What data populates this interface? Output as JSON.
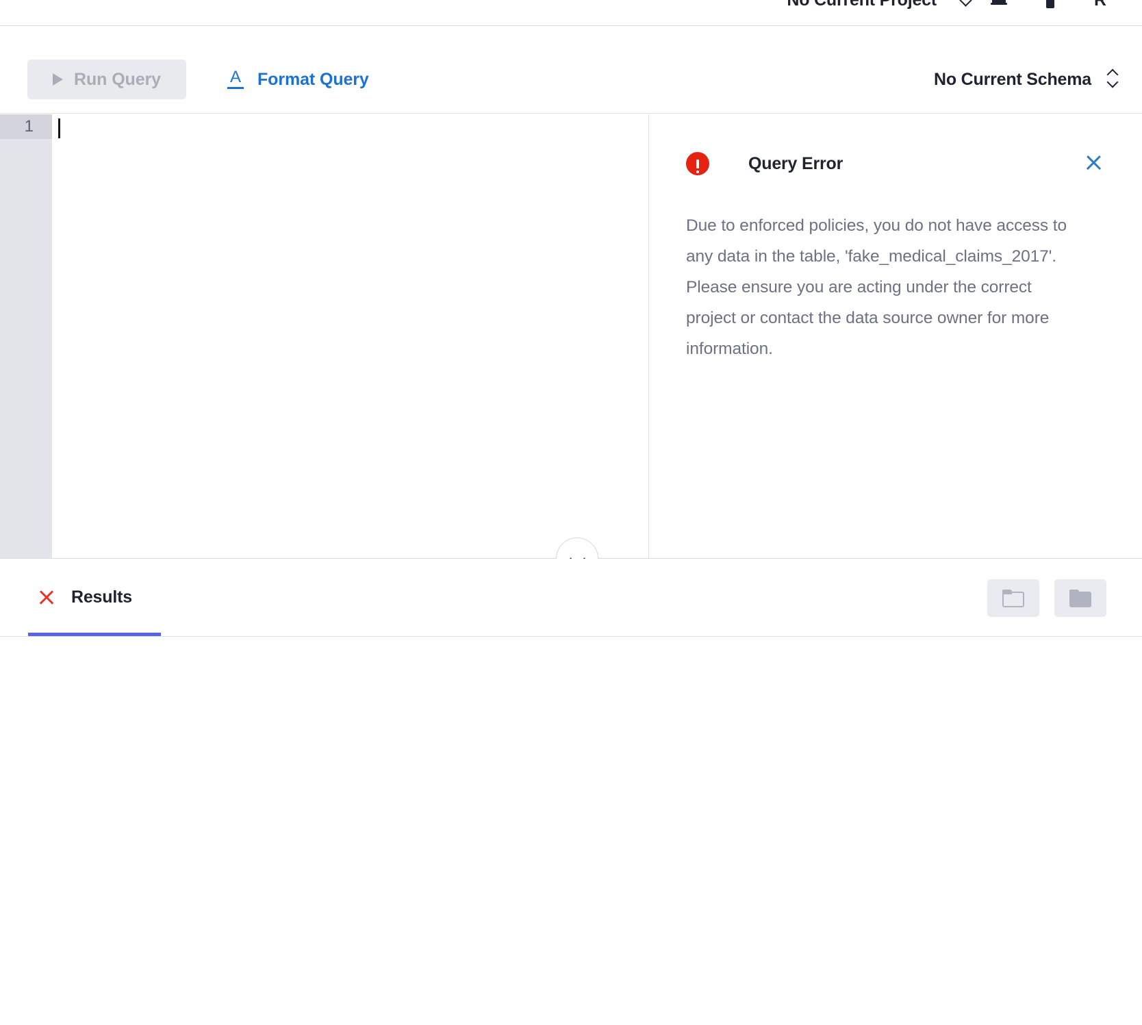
{
  "header": {
    "project_selector": {
      "label": "No Current Project",
      "chevron_icon": "chevron-down-icon"
    },
    "notifications_icon": "bell-icon",
    "bookmark_icon": "bookmark-icon",
    "avatar_initial": "R"
  },
  "toolbar": {
    "run_query_label": "Run Query",
    "run_query_icon": "play-icon",
    "run_query_disabled": true,
    "format_query_label": "Format Query",
    "format_query_icon": "format-text-icon",
    "schema_label": "No Current Schema",
    "schema_icon": "unfold-more-icon"
  },
  "editor": {
    "line_numbers": [
      "1"
    ],
    "content": "",
    "active_line": 1
  },
  "error_panel": {
    "icon": "error-circle-icon",
    "title": "Query Error",
    "message": "Due to enforced policies, you do not have access to any data in the table, 'fake_medical_claims_2017'. Please ensure you are acting under the correct project or contact the data source owner for more information.",
    "close_icon": "close-icon"
  },
  "divider": {
    "collapse_icon": "chevron-down-icon"
  },
  "results": {
    "tab_label": "Results",
    "tab_status_icon": "error-x-icon",
    "tab_active": true,
    "actions": [
      {
        "name": "folder-outline-button",
        "icon": "folder-outline-icon"
      },
      {
        "name": "folder-filled-button",
        "icon": "folder-filled-icon"
      }
    ],
    "rows": []
  },
  "colors": {
    "accent_blue": "#1a73d2",
    "tab_indicator": "#5864e8",
    "error_red": "#e42313",
    "status_x_red": "#e8352a",
    "disabled_gray": "#a9adb8",
    "muted_text": "#6c7183",
    "dark_text": "#1f2330"
  }
}
